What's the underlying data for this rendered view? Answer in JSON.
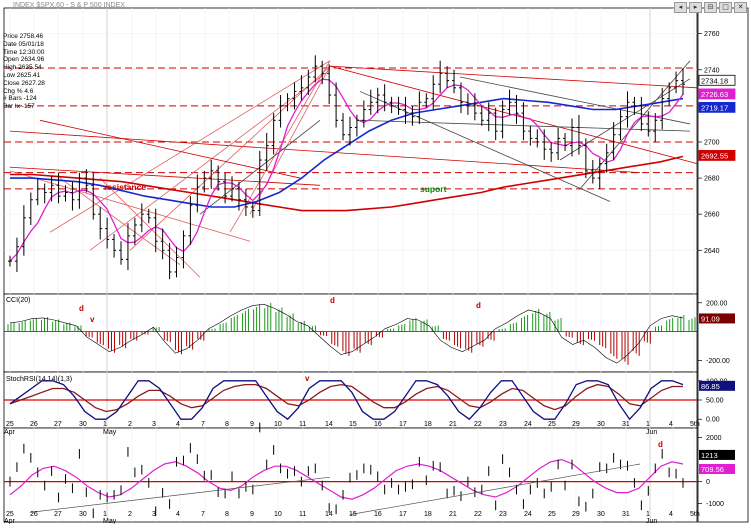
{
  "header": {
    "title": "INDEX $SPX,60 - S & P 500 INDEX"
  },
  "window_buttons": [
    "◂",
    "▸",
    "⊟",
    "□",
    "✕"
  ],
  "price_info": [
    "Price  2758.46",
    "Date  05/01/18",
    "Time  12:30:00",
    "Open  2634.96",
    "High  2635.54",
    "Low  2625.41",
    "Close  2627.28",
    "Chg %  4.6",
    "# Bars  -124",
    "Bar Ix  -157"
  ],
  "annotations": {
    "resistance": "resistance",
    "suport": "suport",
    "d": "d",
    "v": "v"
  },
  "colors": {
    "price_bars": "#000000",
    "ma_red": "#d00000",
    "ma_blue": "#1428d0",
    "ma_magenta": "#e020d0",
    "dashed_red": "#d00000",
    "cci_green": "#1a9a1a",
    "cci_red": "#b00000",
    "stoch_navy": "#101080",
    "stoch_brown": "#8b1a1a",
    "level_red": "#e00000"
  },
  "chart_data": [
    {
      "type": "line",
      "name": "price",
      "ylim": [
        2618,
        2772
      ],
      "yticks": [
        2640,
        2660,
        2680,
        2700,
        2720,
        2740,
        2760
      ],
      "ytick_labels": [
        "2640",
        "2660",
        "2680",
        "2700",
        "2720",
        "2740",
        "2760"
      ],
      "xlabels_top": [
        "25",
        "26",
        "27",
        "30",
        "1",
        "2",
        "3",
        "4",
        "7",
        "8",
        "9",
        "10",
        "11",
        "14",
        "15",
        "16",
        "17",
        "18",
        "21",
        "22",
        "23",
        "24",
        "25",
        "29",
        "30",
        "31",
        "1",
        "4",
        "5th"
      ],
      "xlabels_bottom": [
        "Apr",
        "May",
        "Jun"
      ],
      "ohlc_close": [
        2634,
        2642,
        2658,
        2668,
        2674,
        2672,
        2676,
        2670,
        2672,
        2668,
        2680,
        2676,
        2660,
        2652,
        2646,
        2640,
        2635,
        2648,
        2654,
        2660,
        2658,
        2645,
        2640,
        2628,
        2636,
        2648,
        2665,
        2675,
        2680,
        2684,
        2678,
        2670,
        2674,
        2668,
        2664,
        2662,
        2690,
        2698,
        2712,
        2720,
        2724,
        2728,
        2730,
        2736,
        2742,
        2738,
        2726,
        2712,
        2704,
        2708,
        2712,
        2718,
        2722,
        2726,
        2722,
        2720,
        2718,
        2716,
        2714,
        2722,
        2724,
        2732,
        2738,
        2734,
        2730,
        2722,
        2720,
        2716,
        2712,
        2716,
        2706,
        2718,
        2722,
        2716,
        2706,
        2702,
        2700,
        2696,
        2694,
        2702,
        2698,
        2708,
        2698,
        2684,
        2680,
        2688,
        2694,
        2704,
        2714,
        2722,
        2720,
        2710,
        2706,
        2712,
        2724,
        2730,
        2734,
        2732
      ],
      "ma_red": [
        2682,
        2682,
        2681,
        2680,
        2679,
        2678,
        2676,
        2674,
        2672,
        2670,
        2668,
        2666,
        2664,
        2662,
        2662,
        2662,
        2663,
        2664,
        2666,
        2668,
        2670,
        2672,
        2675,
        2677,
        2679,
        2681,
        2683,
        2685,
        2687,
        2689,
        2692
      ],
      "ma_blue": [
        2680,
        2680,
        2679,
        2678,
        2676,
        2673,
        2670,
        2668,
        2666,
        2664,
        2664,
        2667,
        2672,
        2680,
        2690,
        2698,
        2706,
        2712,
        2716,
        2718,
        2720,
        2722,
        2724,
        2723,
        2722,
        2720,
        2718,
        2718,
        2720,
        2722,
        2724
      ],
      "level_labels": [
        {
          "value": "2734.18",
          "color": "#000000"
        },
        {
          "value": "2726.63",
          "color": "#e020d0"
        },
        {
          "value": "2719.17",
          "color": "#1428d0"
        },
        {
          "value": "2692.55",
          "color": "#d00000"
        }
      ],
      "dashed_levels": [
        2741,
        2720,
        2700,
        2683,
        2674
      ]
    },
    {
      "type": "bar",
      "name": "CCI(20)",
      "ylim": [
        -260,
        240
      ],
      "yticks": [
        200,
        -200
      ],
      "ytick_labels": [
        "200.00",
        "-200.00"
      ],
      "value_label": "91.09",
      "values": [
        60,
        70,
        90,
        95,
        80,
        60,
        40,
        -40,
        -90,
        -140,
        -110,
        -60,
        -20,
        30,
        -70,
        -150,
        -120,
        -60,
        20,
        60,
        110,
        150,
        180,
        190,
        160,
        120,
        70,
        40,
        -30,
        -100,
        -160,
        -140,
        -90,
        -40,
        20,
        50,
        90,
        80,
        40,
        -60,
        -110,
        -140,
        -100,
        -60,
        20,
        60,
        110,
        150,
        130,
        90,
        -40,
        -90,
        -60,
        -110,
        -180,
        -220,
        -160,
        -80,
        40,
        90,
        110,
        95
      ]
    },
    {
      "type": "line",
      "name": "StochRSI",
      "ylim": [
        -15,
        115
      ],
      "yticks": [
        100,
        50,
        0
      ],
      "ytick_labels": [
        "100.00",
        "50.00",
        "0.00"
      ],
      "value_label": "86.85",
      "values_navy": [
        40,
        60,
        80,
        100,
        100,
        90,
        60,
        20,
        0,
        0,
        20,
        60,
        100,
        100,
        80,
        40,
        0,
        0,
        30,
        80,
        100,
        100,
        100,
        100,
        60,
        20,
        0,
        30,
        80,
        100,
        100,
        100,
        70,
        20,
        0,
        0,
        20,
        60,
        100,
        100,
        90,
        60,
        20,
        0,
        30,
        70,
        100,
        100,
        60,
        20,
        0,
        0,
        40,
        90,
        100,
        100,
        90,
        40,
        0,
        30,
        80,
        100,
        100,
        90
      ],
      "values_brown": [
        40,
        50,
        60,
        70,
        80,
        80,
        70,
        50,
        30,
        20,
        25,
        40,
        60,
        75,
        75,
        60,
        40,
        30,
        35,
        55,
        75,
        85,
        90,
        90,
        80,
        60,
        40,
        35,
        50,
        70,
        85,
        90,
        85,
        65,
        45,
        30,
        30,
        45,
        65,
        80,
        85,
        75,
        55,
        35,
        30,
        45,
        65,
        80,
        75,
        55,
        35,
        25,
        35,
        60,
        80,
        90,
        85,
        65,
        40,
        35,
        55,
        75,
        85,
        85
      ]
    },
    {
      "type": "line",
      "name": "oscillator",
      "ylim": [
        -1700,
        2300
      ],
      "yticks": [
        2000,
        0,
        -1000
      ],
      "ytick_labels": [
        "2000",
        "0",
        "-1000"
      ],
      "value_label_1": "1213",
      "value_label_2": "709.56",
      "values_magenta": [
        -600,
        -200,
        300,
        600,
        700,
        500,
        200,
        -200,
        -500,
        -700,
        -600,
        -300,
        100,
        500,
        800,
        900,
        700,
        400,
        0,
        -300,
        -400,
        -200,
        200,
        500,
        700,
        700,
        500,
        200,
        -100,
        -400,
        -700,
        -800,
        -600,
        -300,
        100,
        500,
        700,
        800,
        700,
        500,
        200,
        -100,
        -400,
        -600,
        -700,
        -500,
        -200,
        200,
        600,
        900,
        1000,
        800,
        400,
        0,
        -300,
        -500,
        -500,
        -300,
        200,
        700,
        900,
        800
      ]
    }
  ]
}
